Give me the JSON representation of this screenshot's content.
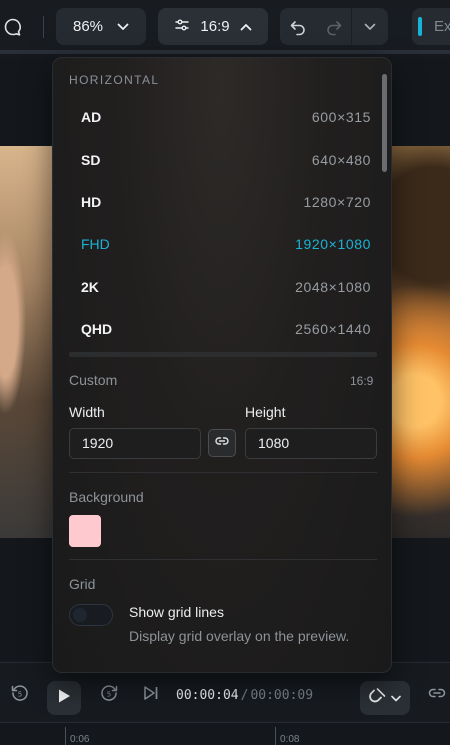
{
  "toolbar": {
    "zoom_value": "86%",
    "aspect_value": "16:9",
    "export_label": "Ex"
  },
  "dropdown": {
    "section_header": "HORIZONTAL",
    "presets": [
      {
        "name": "AD",
        "size": "600×315",
        "selected": false
      },
      {
        "name": "SD",
        "size": "640×480",
        "selected": false
      },
      {
        "name": "HD",
        "size": "1280×720",
        "selected": false
      },
      {
        "name": "FHD",
        "size": "1920×1080",
        "selected": true
      },
      {
        "name": "2K",
        "size": "2048×1080",
        "selected": false
      },
      {
        "name": "QHD",
        "size": "2560×1440",
        "selected": false
      }
    ],
    "custom": {
      "label": "Custom",
      "ratio": "16:9",
      "width_label": "Width",
      "width_value": "1920",
      "height_label": "Height",
      "height_value": "1080"
    },
    "background": {
      "label": "Background",
      "color": "#ffc9d0"
    },
    "grid": {
      "label": "Grid",
      "toggle_label": "Show grid lines",
      "toggle_description": "Display grid overlay on the preview.",
      "enabled": false
    }
  },
  "playback": {
    "current_time": "00:00:04",
    "separator": "/",
    "total_time": "00:00:09"
  },
  "ruler": {
    "ticks": [
      "0:06",
      "0:08"
    ]
  },
  "colors": {
    "accent": "#19b3d6",
    "panel_bg": "#211f1e",
    "app_bg": "#15191e"
  }
}
